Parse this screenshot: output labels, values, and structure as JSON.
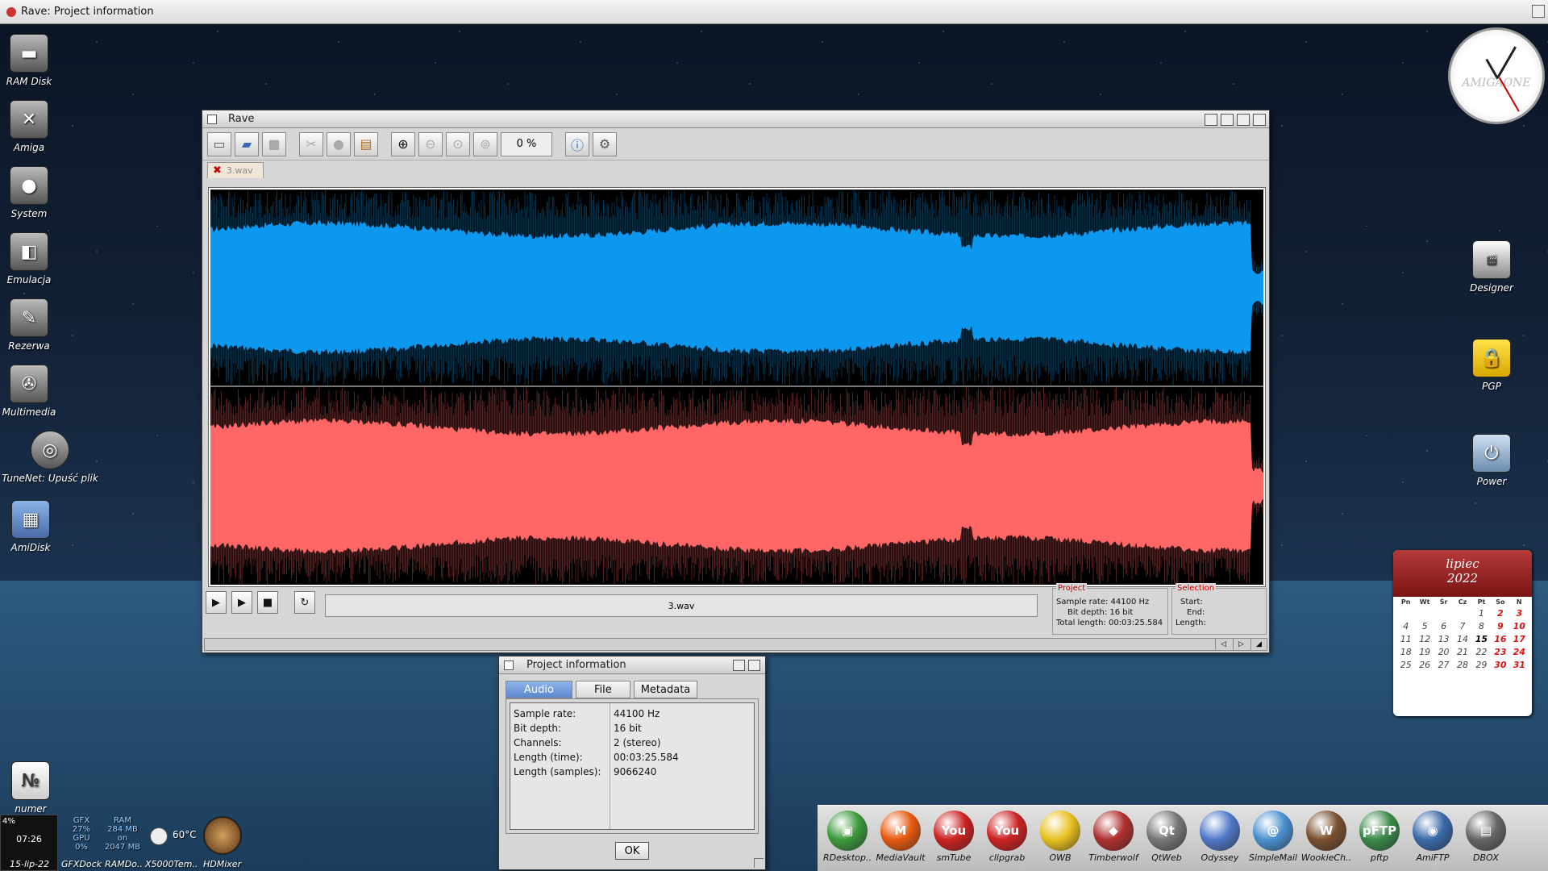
{
  "screen": {
    "title": "Rave: Project information"
  },
  "desktop_icons": [
    {
      "label": "RAM Disk",
      "icon": "ram-disk-icon"
    },
    {
      "label": "Amiga",
      "icon": "amiga-drive-icon"
    },
    {
      "label": "System",
      "icon": "system-drive-icon"
    },
    {
      "label": "Emulacja",
      "icon": "emulation-drive-icon"
    },
    {
      "label": "Rezerwa",
      "icon": "reserve-drive-icon"
    },
    {
      "label": "Multimedia",
      "icon": "multimedia-drive-icon"
    },
    {
      "label": "TuneNet: Upuść plik",
      "icon": "tunenet-icon"
    },
    {
      "label": "AmiDisk",
      "icon": "amidisk-icon"
    },
    {
      "label": "numer",
      "icon": "numer-icon"
    }
  ],
  "right_icons": [
    {
      "label": "Designer",
      "icon": "hollywood-designer-icon"
    },
    {
      "label": "PGP",
      "icon": "padlock-icon"
    },
    {
      "label": "Power",
      "icon": "power-icon"
    }
  ],
  "clock": {
    "brand": "AMIGAONE"
  },
  "rave": {
    "title": "Rave",
    "zoom": "0 %",
    "tab_file": "3.wav",
    "status_filename": "3.wav",
    "project": {
      "legend": "Project",
      "sample_rate": "Sample rate: 44100 Hz",
      "bit_depth": "Bit depth: 16 bit",
      "total_length": "Total length: 00:03:25.584"
    },
    "selection": {
      "legend": "Selection",
      "start": "Start:",
      "end": "End:",
      "length": "Length:"
    },
    "colors": {
      "left_channel": "#0c98ee",
      "right_channel": "#ff6767",
      "background": "#000000"
    }
  },
  "dialog": {
    "title": "Project information",
    "tabs": [
      "Audio",
      "File",
      "Metadata"
    ],
    "active_tab": "Audio",
    "rows": [
      {
        "key": "Sample rate:",
        "value": "44100 Hz"
      },
      {
        "key": "Bit depth:",
        "value": "16 bit"
      },
      {
        "key": "Channels:",
        "value": "2 (stereo)"
      },
      {
        "key": "Length (time):",
        "value": "00:03:25.584"
      },
      {
        "key": "Length (samples):",
        "value": "9066240"
      }
    ],
    "ok": "OK"
  },
  "calendar": {
    "month": "lipiec",
    "year": "2022",
    "weekdays": [
      "Pn",
      "Wt",
      "Śr",
      "Cz",
      "Pt",
      "So",
      "N"
    ],
    "days": [
      "",
      "",
      "",
      "",
      "1",
      "2",
      "3",
      "4",
      "5",
      "6",
      "7",
      "8",
      "9",
      "10",
      "11",
      "12",
      "13",
      "14",
      "15",
      "16",
      "17",
      "18",
      "19",
      "20",
      "21",
      "22",
      "23",
      "24",
      "25",
      "26",
      "27",
      "28",
      "29",
      "30",
      "31"
    ],
    "today": "15"
  },
  "dock": [
    {
      "label": "RDesktop..",
      "color": "#3c9a3c",
      "glyph": "▣"
    },
    {
      "label": "MediaVault",
      "color": "#e85a10",
      "glyph": "M"
    },
    {
      "label": "smTube",
      "color": "#cc2222",
      "glyph": "You"
    },
    {
      "label": "clipgrab",
      "color": "#cc2222",
      "glyph": "You"
    },
    {
      "label": "OWB",
      "color": "#e8c020",
      "glyph": ""
    },
    {
      "label": "Timberwolf",
      "color": "#b03030",
      "glyph": "◆"
    },
    {
      "label": "QtWeb",
      "color": "#777",
      "glyph": "Qt"
    },
    {
      "label": "Odyssey",
      "color": "#5078c8",
      "glyph": ""
    },
    {
      "label": "SimpleMail",
      "color": "#4a90d0",
      "glyph": "@"
    },
    {
      "label": "WookieCh..",
      "color": "#7a5030",
      "glyph": "W"
    },
    {
      "label": "pftp",
      "color": "#3a8a4a",
      "glyph": "pFTP"
    },
    {
      "label": "AmiFTP",
      "color": "#3a6aaa",
      "glyph": "◉"
    },
    {
      "label": "DBOX",
      "color": "#666",
      "glyph": "▤"
    }
  ],
  "status": {
    "cpu": "4%",
    "time": "07:26",
    "date": "15-lip-22",
    "gfx": "GFX",
    "gfx_pct": "27%",
    "gpu": "GPU",
    "gpu_pct": "0%",
    "ram": "RAM",
    "ram_mb": "284 MB",
    "ram_on": "on",
    "ram_total": "2047 MB",
    "temp": "60°C",
    "labels": [
      "GFXDock",
      "RAMDo..",
      "X5000Tem..",
      "HDMixer"
    ]
  }
}
